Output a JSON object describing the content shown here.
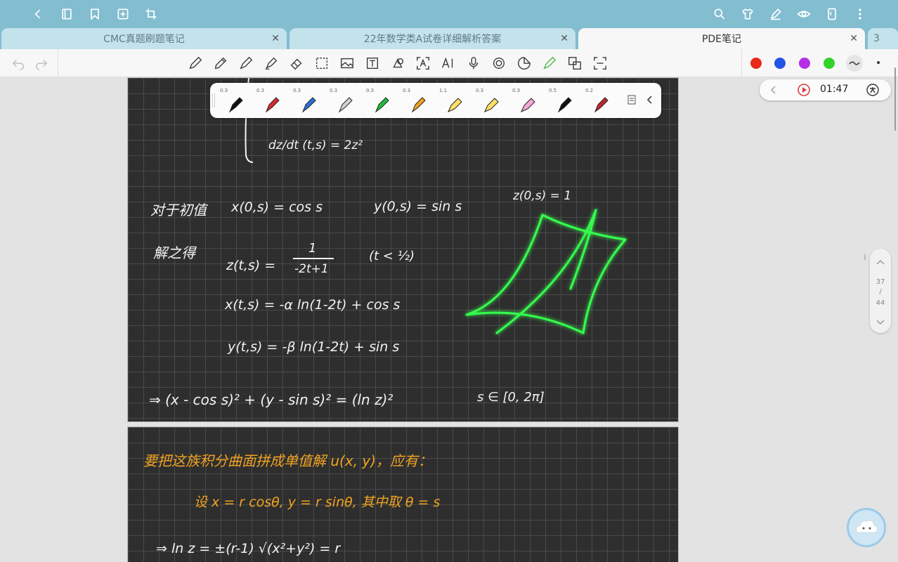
{
  "tabs": [
    {
      "label": "CMC真题刷题笔记",
      "active": false
    },
    {
      "label": "22年数学类A试卷详细解析答案",
      "active": false
    },
    {
      "label": "PDE笔记",
      "active": true
    },
    {
      "label": "3",
      "active": false
    }
  ],
  "tab_close_glyph": "✕",
  "pen_palette": {
    "sizes": [
      "0.3",
      "0.3",
      "0.3",
      "0.3",
      "0.3",
      "0.3",
      "1.1",
      "0.3",
      "0.3",
      "0.5",
      "0.2"
    ],
    "colors": [
      "#111111",
      "#d92b2b",
      "#2b6fd9",
      "#333333",
      "#1fbf3a",
      "#f0a321",
      "#ffe066",
      "#ffe066",
      "#f4a6d7",
      "#111111",
      "#c1272d"
    ]
  },
  "toolbar_colors": [
    "#e8291c",
    "#2255e6",
    "#b52ee6",
    "#31d42c"
  ],
  "timer": {
    "time": "01:47"
  },
  "page_nav": {
    "current": "37",
    "separator": "/",
    "total": "44"
  },
  "page1": {
    "dz_line": "dz/dt (t,s) = 2z²",
    "initial_label": "对于初值",
    "x0": "x(0,s) = cos s",
    "y0": "y(0,s) = sin s",
    "z0": "z(0,s) = 1",
    "solve_label": "解之得",
    "z_sol_lhs": "z(t,s) =",
    "z_sol_num": "1",
    "z_sol_den": "-2t+1",
    "z_sol_cond": "(t < ½)",
    "x_sol": "x(t,s) = -α ln(1-2t) + cos s",
    "y_sol": "y(t,s) = -β ln(1-2t) + sin s",
    "implies": "⇒ (x - cos s)² + (y - sin s)² = (ln z)²",
    "s_range": "s ∈ [0, 2π]"
  },
  "page2": {
    "line1": "要把这族积分曲面拼成单值解 u(x, y)，应有：",
    "line2": "设 x = r cosθ,  y = r sinθ,  其中取 θ = s",
    "line3": "⇒   ln z = ±(r-1)      √(x²+y²) = r"
  }
}
